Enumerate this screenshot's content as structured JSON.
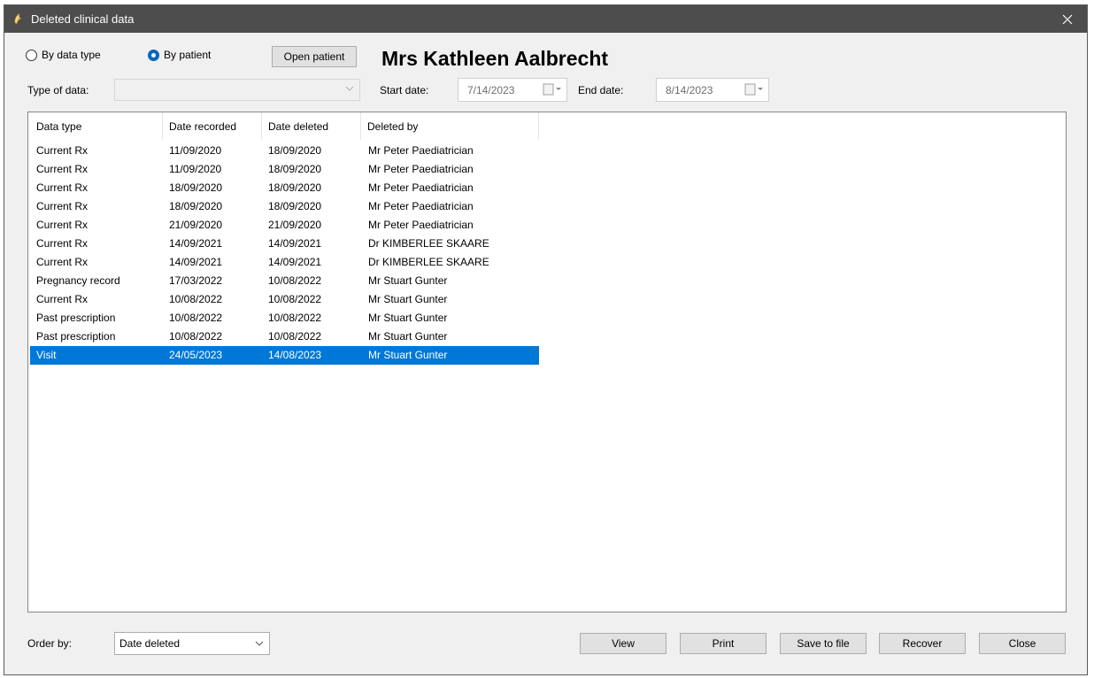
{
  "window": {
    "title": "Deleted clinical data"
  },
  "filters": {
    "by_data_type_label": "By data type",
    "by_patient_label": "By patient",
    "selected_mode": "By patient",
    "open_patient_label": "Open patient",
    "type_of_data_label": "Type of data:",
    "type_of_data_value": "",
    "start_date_label": "Start date:",
    "start_date_value": "7/14/2023",
    "end_date_label": "End date:",
    "end_date_value": "8/14/2023"
  },
  "patient": {
    "name": "Mrs Kathleen Aalbrecht"
  },
  "table": {
    "columns": [
      "Data type",
      "Date recorded",
      "Date deleted",
      "Deleted by"
    ],
    "rows": [
      [
        "Current Rx",
        "11/09/2020",
        "18/09/2020",
        "Mr Peter Paediatrician"
      ],
      [
        "Current Rx",
        "11/09/2020",
        "18/09/2020",
        "Mr Peter Paediatrician"
      ],
      [
        "Current Rx",
        "18/09/2020",
        "18/09/2020",
        "Mr Peter Paediatrician"
      ],
      [
        "Current Rx",
        "18/09/2020",
        "18/09/2020",
        "Mr Peter Paediatrician"
      ],
      [
        "Current Rx",
        "21/09/2020",
        "21/09/2020",
        "Mr Peter Paediatrician"
      ],
      [
        "Current Rx",
        "14/09/2021",
        "14/09/2021",
        "Dr KIMBERLEE SKAARE"
      ],
      [
        "Current Rx",
        "14/09/2021",
        "14/09/2021",
        "Dr KIMBERLEE SKAARE"
      ],
      [
        "Pregnancy record",
        "17/03/2022",
        "10/08/2022",
        "Mr Stuart Gunter"
      ],
      [
        "Current Rx",
        "10/08/2022",
        "10/08/2022",
        "Mr Stuart Gunter"
      ],
      [
        "Past prescription",
        "10/08/2022",
        "10/08/2022",
        "Mr Stuart Gunter"
      ],
      [
        "Past prescription",
        "10/08/2022",
        "10/08/2022",
        "Mr Stuart Gunter"
      ],
      [
        "Visit",
        "24/05/2023",
        "14/08/2023",
        "Mr Stuart Gunter"
      ]
    ],
    "selected_row": 11
  },
  "footer": {
    "order_by_label": "Order by:",
    "order_by_value": "Date deleted",
    "view_label": "View",
    "print_label": "Print",
    "save_label": "Save to file",
    "recover_label": "Recover",
    "close_label": "Close"
  },
  "colors": {
    "titlebar": "#4d4d4d",
    "selection": "#0078d7",
    "radio_checked": "#0067c0"
  }
}
